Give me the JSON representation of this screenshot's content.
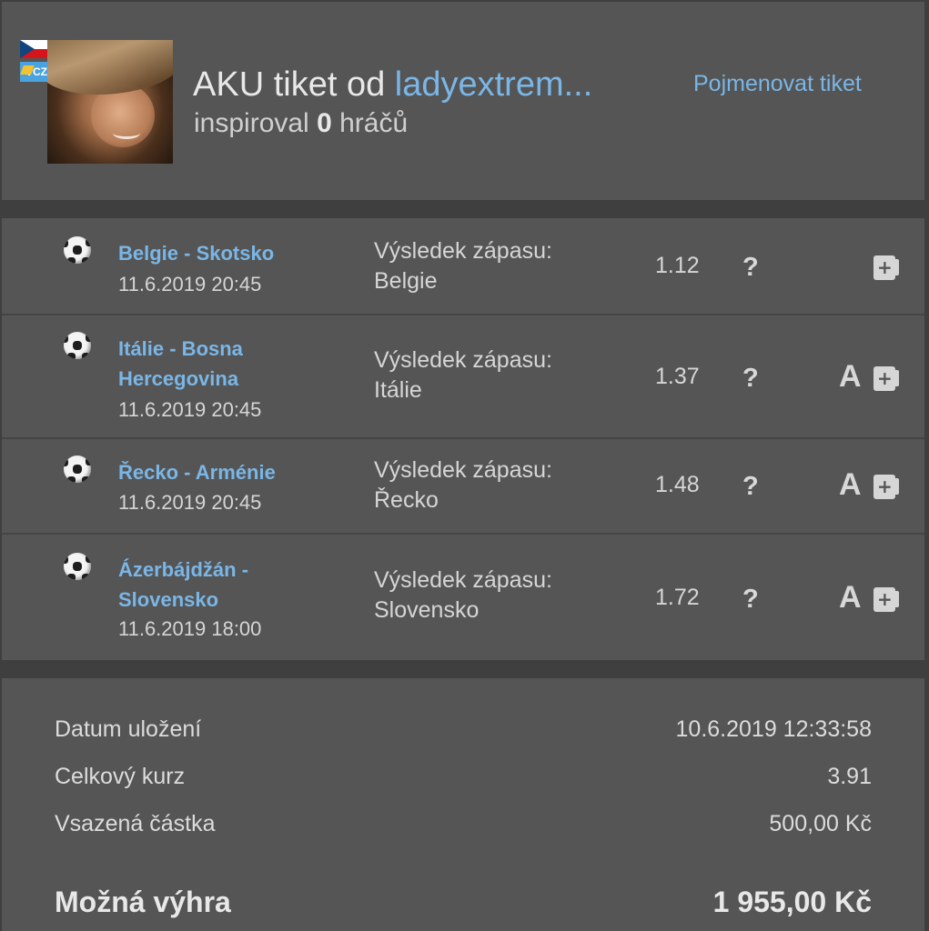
{
  "header": {
    "flag_icon": "czech-flag-icon",
    "vcz_badge": "VCZ",
    "title_prefix": "AKU tiket od ",
    "username": "ladyextrem...",
    "inspired_prefix": "inspiroval ",
    "inspired_count": "0",
    "inspired_suffix": " hráčů",
    "rename_link": "Pojmenovat tiket"
  },
  "matches": [
    {
      "name": "Belgie - Skotsko",
      "date": "11.6.2019 20:45",
      "bet_type": "Výsledek zápasu:",
      "bet_value": "Belgie",
      "odds": "1.12",
      "status": "?",
      "a_badge": ""
    },
    {
      "name": "Itálie - Bosna Hercegovina",
      "date": "11.6.2019 20:45",
      "bet_type": "Výsledek zápasu:",
      "bet_value": "Itálie",
      "odds": "1.37",
      "status": "?",
      "a_badge": "A"
    },
    {
      "name": "Řecko - Arménie",
      "date": "11.6.2019 20:45",
      "bet_type": "Výsledek zápasu:",
      "bet_value": "Řecko",
      "odds": "1.48",
      "status": "?",
      "a_badge": "A"
    },
    {
      "name": "Ázerbájdžán - Slovensko",
      "date": "11.6.2019 18:00",
      "bet_type": "Výsledek zápasu:",
      "bet_value": "Slovensko",
      "odds": "1.72",
      "status": "?",
      "a_badge": "A"
    }
  ],
  "summary": {
    "saved_label": "Datum uložení",
    "saved_value": "10.6.2019 12:33:58",
    "total_odds_label": "Celkový kurz",
    "total_odds_value": "3.91",
    "stake_label": "Vsazená částka",
    "stake_value": "500,00 Kč",
    "win_label": "Možná výhra",
    "win_value": "1 955,00 Kč"
  },
  "colors": {
    "link": "#7ab6e6",
    "panel": "#555555",
    "background": "#3f3f3f"
  }
}
